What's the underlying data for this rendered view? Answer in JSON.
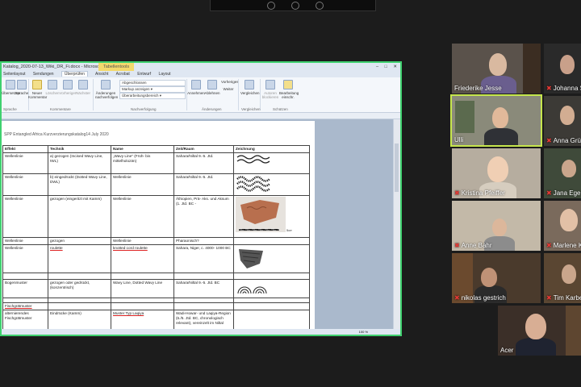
{
  "window": {
    "title": "Katalog_2020-07-13_Wiki_DR_Fi.docx - Microsoft Word",
    "context_tab": "Tabellentools",
    "controls": [
      "–",
      "□",
      "✕"
    ]
  },
  "ribbon": {
    "tabs": [
      "Seitenlayout",
      "Sendungen",
      "Überprüfen",
      "Ansicht",
      "Acrobat",
      "Entwurf",
      "Layout"
    ],
    "active_tab": "Überprüfen",
    "buttons": [
      "Übersetzen",
      "Sprache",
      "Neuer Kommentar",
      "Löschen",
      "Vorheriger",
      "Nächster",
      "Änderungen nachverfolgen",
      "Annehmen",
      "Ablehnen",
      "Vorheriges",
      "Weiter",
      "Vergleichen",
      "Autoren blockieren",
      "Bearbeitung einschr."
    ],
    "dropdowns": [
      "Abgeschlossen",
      "Markup anzeigen ▾",
      "Überarbeitungsbereich ▾"
    ],
    "groups": [
      "Sprache",
      "Kommentare",
      "Nachverfolgung",
      "Änderungen",
      "Vergleichen",
      "Schützen"
    ]
  },
  "document": {
    "header": "SPP Entangled Africa Kurzverzierungskatalog14 July 2020",
    "columns": [
      "Effekt",
      "Technik",
      "Name",
      "Zeit/Raum",
      "Zeichnung"
    ],
    "rows": [
      [
        "Wellenlinie",
        "a) gezogen (Incised Wavy Line, IWL)",
        "„Wavy Line\" (Früh- bis mittelholozän)",
        "Sahara/Niltal 9.-5. Jtd.",
        ""
      ],
      [
        "Wellenlinie",
        "b) eingedrückt (Dotted Wavy Line, DWL)",
        "Wellenlinie",
        "Sahara/Niltal 9.-5. Jtd.",
        ""
      ],
      [
        "Wellenlinie",
        "gezogen (eingeritzt mit Kamm)",
        "Wellenlinie",
        "Äthiopien, Prä- Aks. und Aksum (1. Jtd. BC -",
        ""
      ],
      [
        "Wellenlinie",
        "gezogen",
        "Wellenlinie",
        "Pharaonisch?",
        ""
      ],
      [
        "Wellenlinie",
        "roulette",
        "knotted cord roulette",
        "Sahara, Niger, c. 4000- 1000 BC",
        ""
      ],
      [
        "",
        "",
        "",
        "",
        ""
      ],
      [
        "Bogenmuster",
        "gezogen oder gedrückt, (konzentrisch)",
        "Wavy Line, Dotted Wavy Line",
        "Sahara/Niltal 9.-5. Jtd. BC",
        ""
      ],
      [
        "",
        "",
        "",
        "",
        ""
      ],
      [
        "Fischgrätmuster",
        "",
        "",
        "",
        ""
      ],
      [
        "alternierendes Fischgrätmuster",
        "Eindrücke (Kamm)",
        "Muster Typ Laqiya",
        "Wadi-Howar- und Laqiya-Region (6./5. Jtd. BC, chronologisch relevant), vereinzelt im Niltal",
        ""
      ]
    ],
    "scale_label": "5cm"
  },
  "status": {
    "zoom": "100 %"
  },
  "participants": [
    {
      "name": "Friederike Jesse",
      "muted": false
    },
    {
      "name": "Johanna Sigl",
      "muted": true
    },
    {
      "name": "Ulli",
      "muted": false,
      "active": true
    },
    {
      "name": "Anna Grünen",
      "muted": true
    },
    {
      "name": "Kristina Pfeiffer",
      "muted": true
    },
    {
      "name": "Jana Eger",
      "muted": true
    },
    {
      "name": "Anne Bahr",
      "muted": true
    },
    {
      "name": "Marlene Köster",
      "muted": true
    },
    {
      "name": "nikolas gestrich",
      "muted": true
    },
    {
      "name": "Tim Karberg",
      "muted": true
    },
    {
      "name": "Acer",
      "muted": false
    }
  ],
  "colors": {
    "active_speaker": "#c6e64c",
    "share_border": "#3fd16f",
    "muted_icon": "#e53935"
  }
}
